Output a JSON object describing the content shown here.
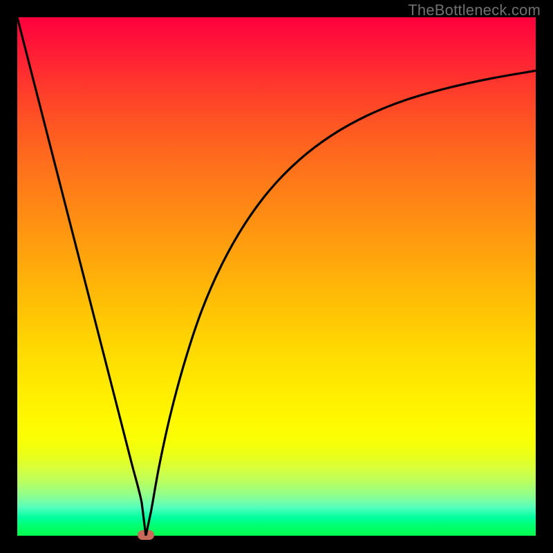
{
  "watermark": "TheBottleneck.com",
  "chart_data": {
    "type": "line",
    "title": "",
    "xlabel": "",
    "ylabel": "",
    "xlim": [
      0,
      100
    ],
    "ylim": [
      0,
      100
    ],
    "grid": false,
    "curve": {
      "x": [
        0,
        2,
        4,
        6,
        8,
        10,
        12,
        14,
        16,
        18,
        20,
        22,
        24,
        24.8,
        25.8,
        27.4,
        29.6,
        32.4,
        35.6,
        39.4,
        43.8,
        48.8,
        54.4,
        60.6,
        67.4,
        74.8,
        82.8,
        91.4,
        100
      ],
      "y": [
        100,
        92.2,
        84.4,
        76.6,
        68.8,
        61,
        53.2,
        45.4,
        37.6,
        29.8,
        22,
        14.2,
        6.4,
        0,
        4.7,
        13.6,
        23.6,
        33.9,
        43.5,
        52.2,
        60.0,
        66.8,
        72.5,
        77.2,
        81.0,
        84.0,
        86.3,
        88.2,
        89.7
      ]
    },
    "marker": {
      "x": 24.8,
      "y": 0,
      "color": "#c76a5a",
      "shape": "pill"
    },
    "background_gradient": {
      "top_color": "#ff003d",
      "bottom_color": "#00ff4e",
      "orientation": "vertical"
    }
  }
}
